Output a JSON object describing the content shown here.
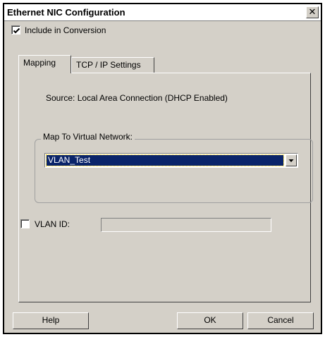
{
  "window": {
    "title": "Ethernet NIC Configuration",
    "close_label": "✕"
  },
  "include_in_conversion": {
    "label": "Include in Conversion",
    "checked": true
  },
  "tabs": [
    {
      "label": "Mapping",
      "active": true
    },
    {
      "label": "TCP / IP Settings",
      "active": false
    }
  ],
  "mapping": {
    "source_text": "Source:  Local Area Connection (DHCP Enabled)",
    "group_label": "Map To Virtual Network:",
    "selected_network": "VLAN_Test",
    "vlan_id_label": "VLAN ID:",
    "vlan_id_checked": false,
    "vlan_id_value": ""
  },
  "buttons": {
    "help": "Help",
    "ok": "OK",
    "cancel": "Cancel"
  },
  "icons": {
    "checkmark": "checkmark-icon",
    "dropdown": "chevron-down-icon",
    "close": "close-icon"
  }
}
